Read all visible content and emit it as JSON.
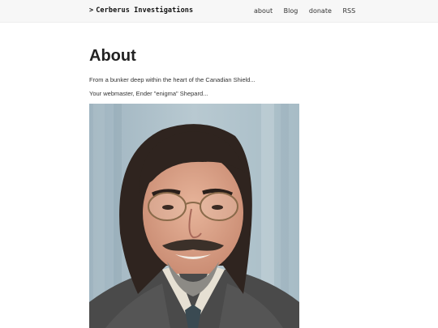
{
  "header": {
    "brand_caret": ">",
    "brand_name": "Cerberus Investigations",
    "nav": [
      "about",
      "Blog",
      "donate",
      "RSS"
    ]
  },
  "main": {
    "title": "About",
    "paragraphs": [
      "From a bunker deep within the heart of the Canadian Shield...",
      "Your webmaster, Ender \"enigma\" Shepard..."
    ]
  },
  "photo": {
    "subject": "portrait of the webmaster"
  },
  "colors": {
    "header_bg": "#f7f7f7",
    "text": "#222222"
  }
}
